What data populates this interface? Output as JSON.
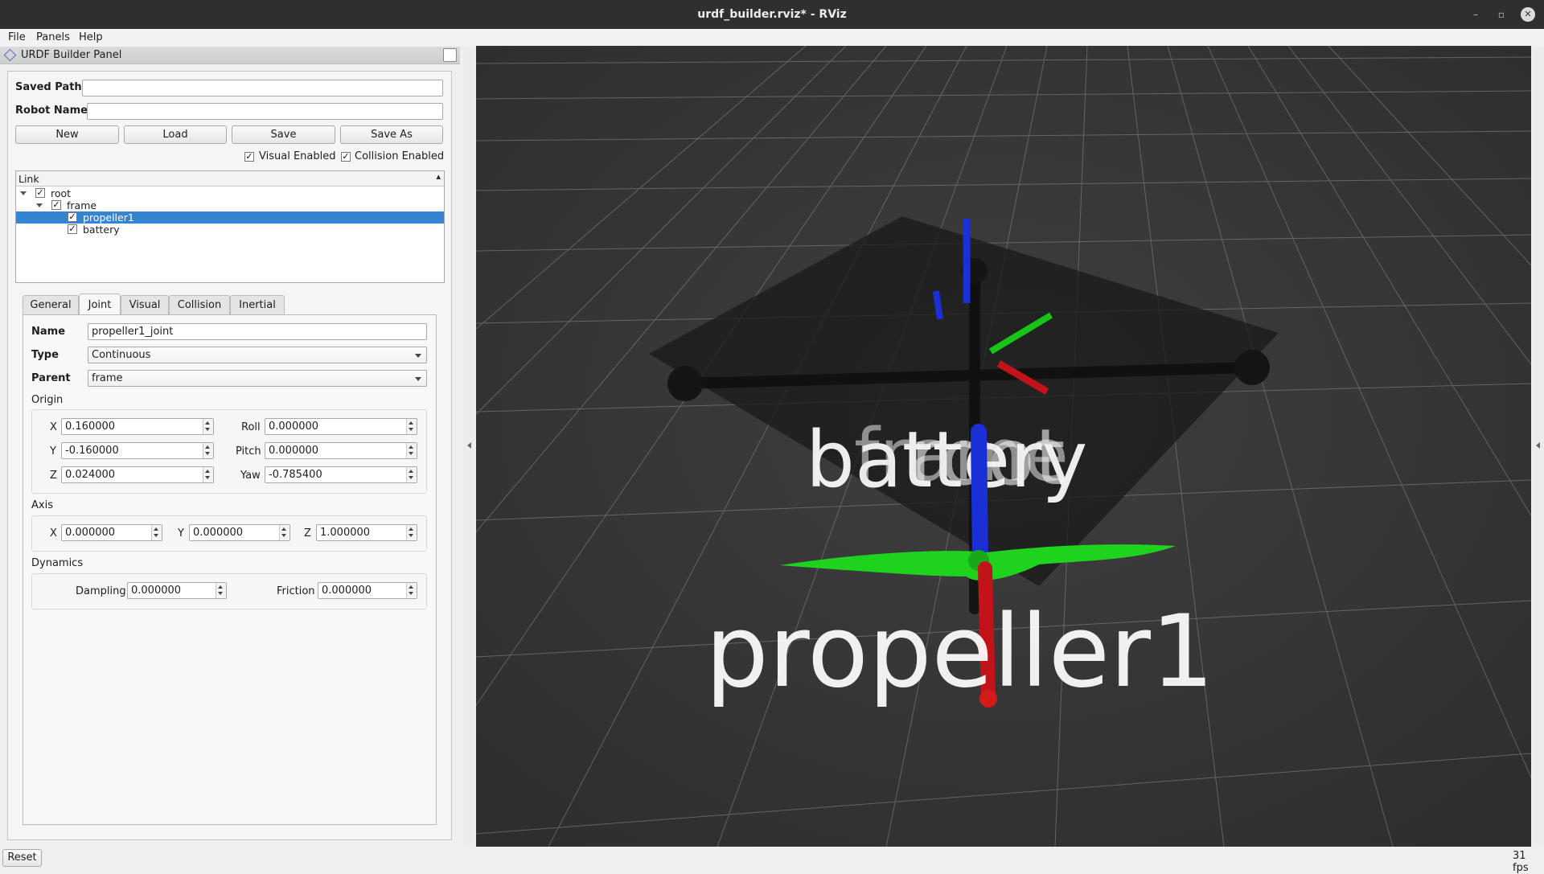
{
  "window": {
    "title": "urdf_builder.rviz* - RViz",
    "minimize_glyph": "–",
    "restore_glyph": "▫",
    "close_glyph": "✕"
  },
  "menubar": {
    "file": "File",
    "panels": "Panels",
    "help": "Help"
  },
  "panel": {
    "title": "URDF Builder Panel",
    "saved_path_label": "Saved Path",
    "saved_path_value": "",
    "robot_name_label": "Robot Name",
    "robot_name_value": "",
    "buttons": {
      "new": "New",
      "load": "Load",
      "save": "Save",
      "save_as": "Save As"
    },
    "visual_enabled_label": "Visual Enabled",
    "visual_enabled": true,
    "collision_enabled_label": "Collision Enabled",
    "collision_enabled": true,
    "check_glyph": "✓",
    "tree": {
      "header": "Link",
      "header_sort_glyph": "▴",
      "nodes": [
        {
          "label": "root",
          "checked": true,
          "expanded": true
        },
        {
          "label": "frame",
          "checked": true,
          "expanded": true
        },
        {
          "label": "propeller1",
          "checked": true,
          "selected": true
        },
        {
          "label": "battery",
          "checked": true
        }
      ]
    },
    "tabs": {
      "general": "General",
      "joint": "Joint",
      "visual": "Visual",
      "collision": "Collision",
      "inertial": "Inertial",
      "active": "Joint"
    },
    "joint": {
      "name_label": "Name",
      "name_value": "propeller1_joint",
      "type_label": "Type",
      "type_value": "Continuous",
      "parent_label": "Parent",
      "parent_value": "frame",
      "origin_label": "Origin",
      "origin": {
        "x_label": "X",
        "x": "0.160000",
        "y_label": "Y",
        "y": "-0.160000",
        "z_label": "Z",
        "z": "0.024000",
        "roll_label": "Roll",
        "roll": "0.000000",
        "pitch_label": "Pitch",
        "pitch": "0.000000",
        "yaw_label": "Yaw",
        "yaw": "-0.785400"
      },
      "axis_label": "Axis",
      "axis": {
        "x_label": "X",
        "x": "0.000000",
        "y_label": "Y",
        "y": "0.000000",
        "z_label": "Z",
        "z": "1.000000"
      },
      "dynamics_label": "Dynamics",
      "dynamics": {
        "damping_label": "Dampling",
        "damping": "0.000000",
        "friction_label": "Friction",
        "friction": "0.000000"
      }
    }
  },
  "viewport": {
    "overlapping_labels": [
      "battery",
      "frame",
      "root"
    ],
    "propeller_label": "propeller1",
    "axis_colors": {
      "x": "#c0141a",
      "y": "#18c418",
      "z": "#1a2fd6"
    },
    "background": "#3a3a3a",
    "propeller_color": "#1ed21e"
  },
  "status": {
    "reset_button": "Reset",
    "fps": "31 fps"
  }
}
